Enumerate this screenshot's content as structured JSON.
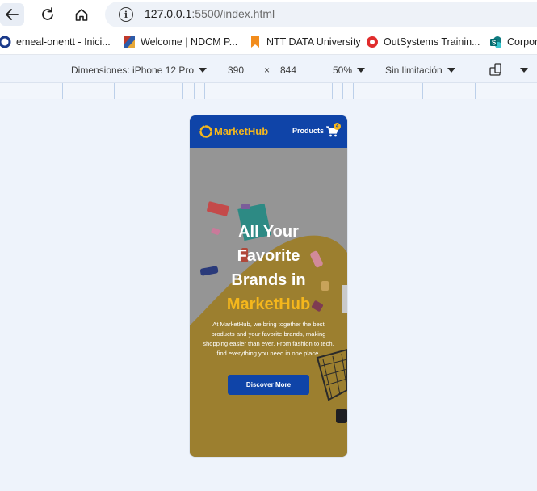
{
  "browser": {
    "url_host": "127.0.0.1",
    "url_rest": ":5500/index.html",
    "bookmarks": [
      {
        "label": "emeal-onentt - Inici...",
        "icon": "ring-icon",
        "color": "#1a3a8a"
      },
      {
        "label": "Welcome | NDCM P...",
        "icon": "ndcm-icon",
        "color": "#c0392b"
      },
      {
        "label": "NTT DATA University",
        "icon": "bookmark-icon",
        "color": "#f28c1c"
      },
      {
        "label": "OutSystems Trainin...",
        "icon": "outsystems-icon",
        "color": "#e02c2c"
      },
      {
        "label": "Corpor",
        "icon": "sharepoint-icon",
        "color": "#038387"
      }
    ]
  },
  "devtools": {
    "dimensions_label": "Dimensiones: iPhone 12 Pro",
    "width": "390",
    "times": "×",
    "height": "844",
    "zoom": "50%",
    "throttle": "Sin limitación"
  },
  "site": {
    "brand": "MarketHub",
    "nav_products": "Products",
    "cart_count": "4",
    "hero": {
      "title_l1": "All Your",
      "title_l2": "Favorite",
      "title_l3": "Brands in",
      "title_highlight": "MarketHub",
      "description": "At MarketHub, we bring together the best products and your favorite brands, making shopping easier than ever. From fashion to tech, find everything you need in one place.",
      "cta": "Discover More"
    },
    "colors": {
      "primary": "#0f44a8",
      "accent": "#f5b71c",
      "hero_yellow": "#9c7f2f",
      "hero_gray": "#959595"
    }
  }
}
